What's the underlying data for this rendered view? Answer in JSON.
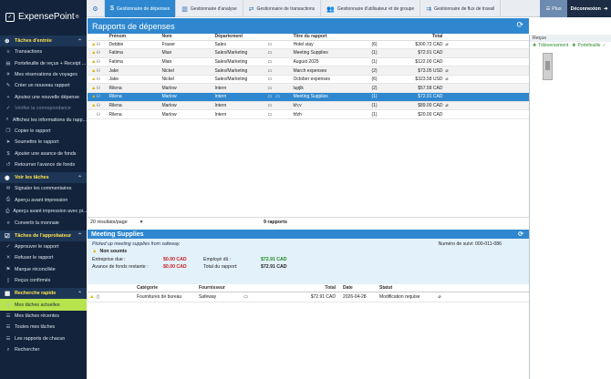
{
  "brand": {
    "name": "ExpensePoint",
    "trademark": "®"
  },
  "sidebar": {
    "sections": [
      {
        "title": "Tâches d'entrée",
        "items": [
          {
            "label": "Transactions",
            "icon": "list"
          },
          {
            "label": "Portefeuille de reçus + Receipt ...",
            "icon": "wallet"
          },
          {
            "label": "Mes réservations de voyages",
            "icon": "plane"
          },
          {
            "label": "Créer un nouveau rapport",
            "icon": "pencil"
          },
          {
            "label": "Ajoutez une nouvelle dépense",
            "icon": "plus"
          },
          {
            "label": "Vérifier la correspondance",
            "icon": "check",
            "dim": true
          },
          {
            "label": "Affichez les informations du rapp...",
            "icon": "search"
          },
          {
            "label": "Copier le rapport",
            "icon": "copy"
          },
          {
            "label": "Soumettre le rapport",
            "icon": "send"
          },
          {
            "label": "Ajouter une avance de fonds",
            "icon": "cash"
          },
          {
            "label": "Retourner l'avance de fonds",
            "icon": "return"
          }
        ]
      },
      {
        "title": "Voir les tâches",
        "items": [
          {
            "label": "Signaler les commentaires",
            "icon": "comment"
          },
          {
            "label": "Aperçu avant impression",
            "icon": "print"
          },
          {
            "label": "Aperçu avant impression avec pi...",
            "icon": "print"
          },
          {
            "label": "Convertir la monnaie",
            "icon": "currency"
          }
        ]
      },
      {
        "title": "Tâches de l'approbateur",
        "items": [
          {
            "label": "Approuver le rapport",
            "icon": "check"
          },
          {
            "label": "Refuser le rapport",
            "icon": "close"
          },
          {
            "label": "Marque réconciliée",
            "icon": "flag"
          },
          {
            "label": "Reçus confirmés",
            "icon": "receipt"
          }
        ]
      },
      {
        "title": "Recherche rapide",
        "items": [
          {
            "label": "Mes tâches actuelles",
            "icon": "task",
            "active": true
          },
          {
            "label": "Mes tâches récentes",
            "icon": "task"
          },
          {
            "label": "Toutes mes tâches",
            "icon": "task"
          },
          {
            "label": "Les rapports de chacun",
            "icon": "task"
          },
          {
            "label": "Rechercher",
            "icon": "search"
          }
        ]
      }
    ]
  },
  "topnav": {
    "tabs": [
      {
        "label": "Gestionnaire de dépenses",
        "active": true
      },
      {
        "label": "Gestionnaire d'analyse"
      },
      {
        "label": "Gestionnaire de transactions"
      },
      {
        "label": "Gestionnaire d'utilisateur et de groupe"
      },
      {
        "label": "Gestionnaire de flux de travail"
      }
    ],
    "plus": "Plus",
    "logout": "Déconnexion"
  },
  "reports": {
    "title": "Rapports de dépenses",
    "columns": [
      "Prénom",
      "Nom",
      "Département",
      "Titre du rapport",
      "Total"
    ],
    "rows": [
      {
        "first": "Debbie",
        "last": "Fraser",
        "dept": "Sales",
        "title": "Hotel stay",
        "count": "(6)",
        "total": "$300.72 CAD",
        "warn": true,
        "clip": true,
        "alt": false
      },
      {
        "first": "Fatima",
        "last": "Mian",
        "dept": "Sales/Marketing",
        "title": "Meeting Supplies",
        "count": "(1)",
        "total": "$72.91 CAD",
        "warn": true,
        "clip": false,
        "alt": true
      },
      {
        "first": "Fatima",
        "last": "Mian",
        "dept": "Sales/Marketing",
        "title": "August 2025",
        "count": "(1)",
        "total": "$122.00 CAD",
        "warn": true,
        "clip": false,
        "alt": false
      },
      {
        "first": "Jake",
        "last": "Nickel",
        "dept": "Sales/Marketing",
        "title": "March expenses",
        "count": "(2)",
        "total": "$73.05 USD",
        "warn": true,
        "clip": true,
        "alt": true
      },
      {
        "first": "Jake",
        "last": "Nickel",
        "dept": "Sales/Marketing",
        "title": "October expenses",
        "count": "(6)",
        "total": "$323.58 USD",
        "warn": true,
        "clip": true,
        "alt": false
      },
      {
        "first": "Rilena",
        "last": "Marlow",
        "dept": "Intern",
        "title": "lupjlk",
        "count": "(2)",
        "total": "$57.58 CAD",
        "warn": true,
        "clip": false,
        "alt": true
      },
      {
        "first": "Rilena",
        "last": "Marlow",
        "dept": "Intern",
        "title": "Meeting Supplies",
        "count": "(1)",
        "total": "$72.91 CAD",
        "warn": true,
        "clip": false,
        "selected": true
      },
      {
        "first": "Rilena",
        "last": "Marlow",
        "dept": "Intern",
        "title": "kh;v",
        "count": "(1)",
        "total": "$89.00 CAD",
        "warn": true,
        "clip": true,
        "alt": true
      },
      {
        "first": "Rilena",
        "last": "Marlow",
        "dept": "Intern",
        "title": "hfzh",
        "count": "(1)",
        "total": "$20.00 CAD",
        "warn": false,
        "clip": false,
        "alt": false
      }
    ],
    "per_page": "20 résultats/page",
    "count": "9 rapports"
  },
  "detail": {
    "title": "Meeting Supplies",
    "description": "Picked up meeting supplies from safeway.",
    "tracking": "Numéro de suivi: 000-011-086",
    "status": "Non soumis",
    "amount_due_label": "Entreprise due :",
    "amount_due": "$0.00 CAD",
    "employee_due_label": "Employé dû :",
    "employee_due": "$72.91 CAD",
    "advance_label": "Avance de fonds restante :",
    "advance": "$0.00 CAD",
    "total_label": "Total du rapport:",
    "total": "$72.91 CAD",
    "columns": [
      "Catégorie",
      "Fournisseur",
      "Total",
      "Date",
      "Statut"
    ],
    "items": [
      {
        "category": "Fournitures de bureau",
        "vendor": "Safeway",
        "total": "$72.91 CAD",
        "date": "2026-04-28",
        "status": "Modification requise"
      }
    ]
  },
  "receipts": {
    "title": "Reçus",
    "upload": "Téléversement",
    "wallet": "Portefeuille"
  },
  "colors": {
    "accent": "#2f88cf",
    "sidebar": "#12233b",
    "active_item": "#b6e44c",
    "warning": "#e0b400"
  }
}
